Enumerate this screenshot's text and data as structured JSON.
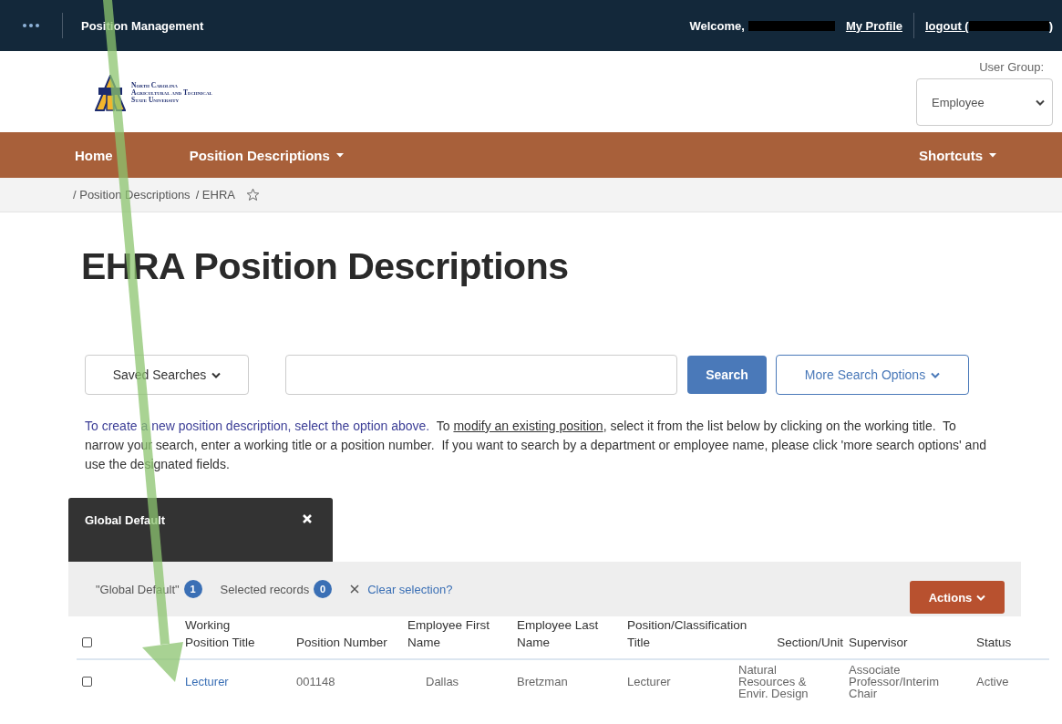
{
  "topbar": {
    "app_title": "Position Management",
    "welcome": "Welcome,",
    "my_profile": "My Profile",
    "logout_prefix": "logout (",
    "logout_suffix": ")"
  },
  "header": {
    "logo_lines": [
      "North Carolina",
      "Agricultural and Technical",
      "State University"
    ],
    "user_group_label": "User Group:",
    "user_group_value": "Employee"
  },
  "nav": {
    "items": [
      {
        "label": "Home",
        "dropdown": false
      },
      {
        "label": "Position Descriptions",
        "dropdown": true
      },
      {
        "label": "Shortcuts",
        "dropdown": true
      }
    ]
  },
  "breadcrumb": {
    "items": [
      "/ Position Descriptions",
      "/ EHRA"
    ]
  },
  "page_title": "EHRA Position Descriptions",
  "search": {
    "saved_searches": "Saved Searches",
    "search_button": "Search",
    "more_options": "More Search Options"
  },
  "help_text": [
    {
      "kind": "highlight",
      "text": "To create a new position description, select the option above."
    },
    {
      "kind": "plain",
      "text": "  To "
    },
    {
      "kind": "link",
      "text": "modify an existing position"
    },
    {
      "kind": "plain",
      "text": ", select it from the list below by clicking on the working title.  To narrow your search, enter a working title or a position number.  If you want to search by a department or employee name, please click 'more search options' and use the designated fields."
    }
  ],
  "saved_search_tab": {
    "label": "Global Default"
  },
  "toolbar": {
    "filters": [
      {
        "label": "\"Global Default\"",
        "count": "1"
      },
      {
        "label": "Selected records",
        "count": "0"
      }
    ],
    "clear": "Clear selection?",
    "actions": "Actions"
  },
  "table": {
    "select_all_checked": false,
    "columns": [
      "Working Position Title",
      "Position Number",
      "Employee First Name",
      "Employee Last Name",
      "Position/Classification Title",
      "Section/Unit",
      "Supervisor",
      "Status"
    ],
    "rows": [
      {
        "checked": false,
        "cells": [
          "Lecturer",
          "001148",
          "Dallas",
          "Bretzman",
          "Lecturer",
          "Natural Resources & Envir. Design",
          "Associate Professor/Interim Chair",
          "Active"
        ]
      }
    ]
  }
}
